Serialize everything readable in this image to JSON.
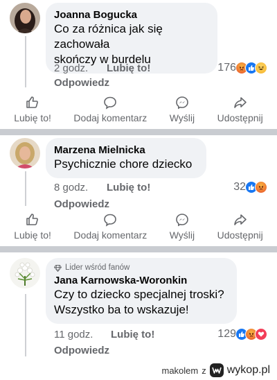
{
  "comments": [
    {
      "author": "Joanna Bogucka",
      "text_line1": "Co za różnica jak się zachowała",
      "text_line2": "skończy w burdelu",
      "time": "2 godz.",
      "like_label": "Lubię to!",
      "reply_label": "Odpowiedz",
      "reaction_count": "176",
      "reactions": [
        "angry",
        "like",
        "haha"
      ]
    },
    {
      "author": "Marzena Mielnicka",
      "text_line1": "Psychicznie chore dziecko",
      "time": "8 godz.",
      "like_label": "Lubię to!",
      "reply_label": "Odpowiedz",
      "reaction_count": "32",
      "reactions": [
        "like",
        "angry"
      ]
    },
    {
      "badge": "Lider wśród fanów",
      "author": "Jana Karnowska-Woronkin",
      "text_line1": "Czy to dziecko specjalnej troski?",
      "text_line2": "Wszystko ba to wskazuje!",
      "time": "11 godz.",
      "like_label": "Lubię to!",
      "reply_label": "Odpowiedz",
      "reaction_count": "129",
      "reactions": [
        "like",
        "angry",
        "love"
      ]
    }
  ],
  "action_bar": {
    "like": "Lubię to!",
    "comment": "Dodaj komentarz",
    "send": "Wyślij",
    "share": "Udostępnij"
  },
  "watermark": {
    "user": "makolem",
    "z": "z",
    "site": "wykop.pl"
  },
  "colors": {
    "secondary_text": "#65676b",
    "bubble_bg": "#f0f2f5",
    "divider": "#c9ccd1",
    "like_blue": "#1877f2"
  }
}
